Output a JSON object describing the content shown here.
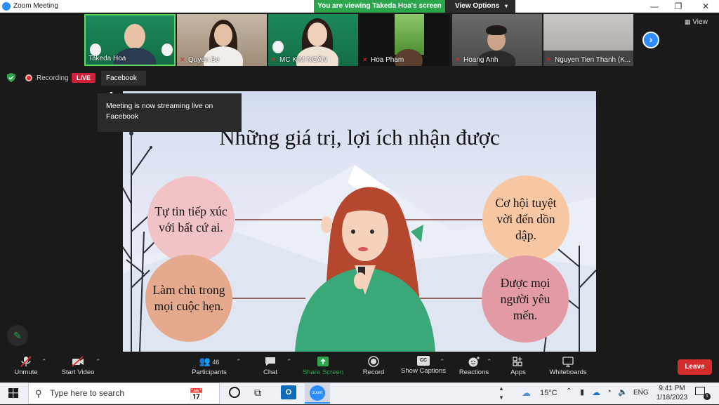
{
  "window": {
    "title": "Zoom Meeting",
    "minimize": "—",
    "restore": "❐",
    "close": "✕"
  },
  "share_banner": {
    "text": "You are viewing Takeda Hoa's screen",
    "view_options": "View Options"
  },
  "participants": [
    {
      "name": "Takeda Hoa",
      "muted": false
    },
    {
      "name": "Quyen Be",
      "muted": true
    },
    {
      "name": "MC KIM NGÂN",
      "muted": true
    },
    {
      "name": "Hoa Pham",
      "muted": true
    },
    {
      "name": "Hoang Anh",
      "muted": true
    },
    {
      "name": "Nguyen Tien Thanh (K...",
      "muted": true
    }
  ],
  "view_button": "View",
  "recording": {
    "label": "Recording",
    "live": "LIVE",
    "platform": "Facebook"
  },
  "tooltip": "Meeting is now streaming live on Facebook",
  "slide": {
    "title": "Những giá trị, lợi ích nhận được",
    "bubbles": [
      {
        "text": "Tự tin tiếp xúc với bất cứ ai.",
        "color": "#f2c3c6"
      },
      {
        "text": "Làm chủ trong mọi cuộc hẹn.",
        "color": "#e5a98d"
      },
      {
        "text": "Cơ hội tuyệt vời đến dồn dập.",
        "color": "#f7c7a4"
      },
      {
        "text": "Được mọi người yêu mến.",
        "color": "#e29aa4"
      }
    ]
  },
  "toolbar": {
    "unmute": "Unmute",
    "start_video": "Start Video",
    "participants": "Participants",
    "participants_count": "46",
    "chat": "Chat",
    "share_screen": "Share Screen",
    "record": "Record",
    "show_captions": "Show Captions",
    "captions_badge": "CC",
    "reactions": "Reactions",
    "apps": "Apps",
    "whiteboards": "Whiteboards",
    "leave": "Leave"
  },
  "taskbar": {
    "search_placeholder": "Type here to search",
    "zoom_app": "zoom",
    "weather": "15°C",
    "language": "ENG",
    "time": "9:41 PM",
    "date": "1/18/2023",
    "notification_count": "1"
  },
  "colors": {
    "zoom_blue": "#2d8cff",
    "share_green": "#2da44e",
    "leave_red": "#d52c2c",
    "live_red": "#d0203a"
  }
}
